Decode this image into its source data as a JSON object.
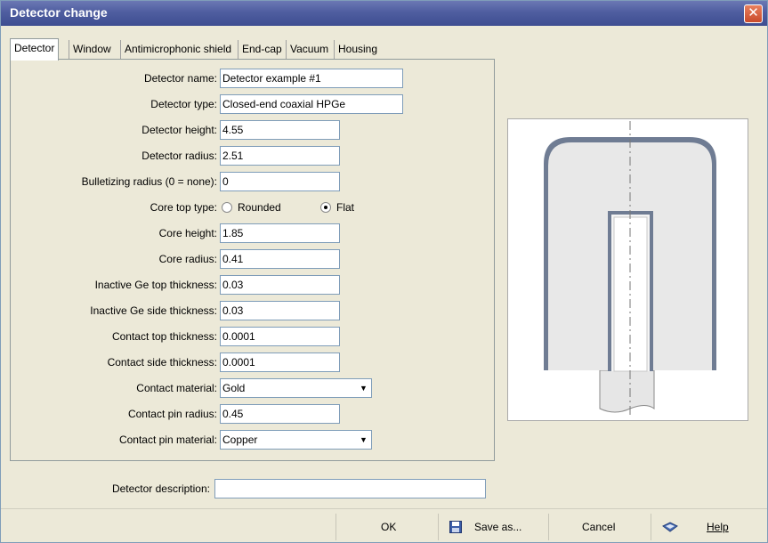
{
  "window": {
    "title": "Detector change",
    "close_glyph": "✕"
  },
  "tabs": [
    {
      "label": "Detector",
      "active": true
    },
    {
      "label": "Window",
      "active": false
    },
    {
      "label": "Antimicrophonic shield",
      "active": false
    },
    {
      "label": "End-cap",
      "active": false
    },
    {
      "label": "Vacuum",
      "active": false
    },
    {
      "label": "Housing",
      "active": false
    }
  ],
  "form": {
    "detector_name": {
      "label": "Detector name:",
      "value": "Detector example #1"
    },
    "detector_type": {
      "label": "Detector type:",
      "value": "Closed-end coaxial HPGe"
    },
    "detector_height": {
      "label": "Detector height:",
      "value": "4.55"
    },
    "detector_radius": {
      "label": "Detector radius:",
      "value": "2.51"
    },
    "bulletizing_radius": {
      "label": "Bulletizing radius (0 = none):",
      "value": "0"
    },
    "core_top_type": {
      "label": "Core top type:",
      "options": [
        "Rounded",
        "Flat"
      ],
      "selected": "Flat"
    },
    "core_height": {
      "label": "Core height:",
      "value": "1.85"
    },
    "core_radius": {
      "label": "Core radius:",
      "value": "0.41"
    },
    "inactive_top": {
      "label": "Inactive Ge top thickness:",
      "value": "0.03"
    },
    "inactive_side": {
      "label": "Inactive Ge side thickness:",
      "value": "0.03"
    },
    "contact_top": {
      "label": "Contact top thickness:",
      "value": "0.0001"
    },
    "contact_side": {
      "label": "Contact side thickness:",
      "value": "0.0001"
    },
    "contact_material": {
      "label": "Contact material:",
      "value": "Gold"
    },
    "contact_pin_radius": {
      "label": "Contact pin radius:",
      "value": "0.45"
    },
    "contact_pin_material": {
      "label": "Contact pin material:",
      "value": "Copper"
    },
    "dropdown_glyph": "▼"
  },
  "description": {
    "label": "Detector description:",
    "value": ""
  },
  "buttons": {
    "ok": "OK",
    "save_as": "Save as...",
    "cancel": "Cancel",
    "help": "Help"
  },
  "icons": {
    "save": "floppy-disk-icon",
    "help": "help-book-icon"
  },
  "colors": {
    "title_bar": "#4f5ea0",
    "close_button": "#d65a36",
    "detector_fill": "#e8e8e8",
    "detector_outline": "#6f7c93"
  }
}
